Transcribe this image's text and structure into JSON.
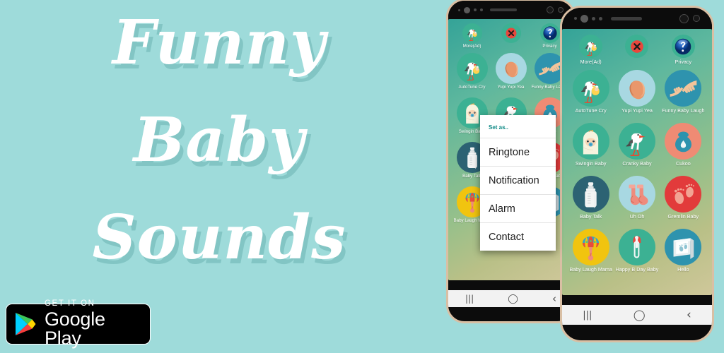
{
  "promo": {
    "title_lines": [
      "Funny",
      "Baby",
      "Sounds"
    ],
    "background_color": "#9edbda",
    "title_color": "#ffffff",
    "title_shadow_color": "#78bebc"
  },
  "store_badge": {
    "small_label": "GET IT ON",
    "big_label": "Google Play",
    "icon": "google-play-triangle-icon",
    "background_color": "#000000",
    "border_color": "#ffffff"
  },
  "phones": {
    "back": {
      "label": "background-phone",
      "frame_color": "#d9bfa4",
      "bezel_color": "#0c0c0c"
    },
    "front": {
      "label": "foreground-phone",
      "frame_color": "#d9bfa4",
      "bezel_color": "#0c0c0c"
    }
  },
  "app": {
    "screen_gradient": [
      "#34a398",
      "#5fb89e",
      "#97c08a",
      "#cfc79a"
    ],
    "top_row": [
      {
        "label": "More(Ad)",
        "icon": "stork-carrying-baby-icon",
        "circle_color": "#3cb193"
      },
      {
        "label": "",
        "icon": "red-x-close-icon",
        "circle_color": "#3cb193"
      },
      {
        "label": "Privacy",
        "icon": "question-mark-help-icon",
        "circle_color": "#3cb193"
      }
    ],
    "sounds": [
      {
        "label": "AutoTune Cry",
        "icon": "stork-carrying-baby-icon",
        "circle_color": "#3cb193"
      },
      {
        "label": "Yupi Yupi Yea",
        "icon": "baby-head-icon",
        "circle_color": "#a8d8e2"
      },
      {
        "label": "Funny Baby Laugh",
        "icon": "two-hands-touching-icon",
        "circle_color": "#2e93ae"
      },
      {
        "label": "Swingin Baby",
        "icon": "swaddled-baby-icon",
        "circle_color": "#3cb193"
      },
      {
        "label": "Cranky Baby",
        "icon": "stork-standing-icon",
        "circle_color": "#3cb193"
      },
      {
        "label": "Cukoo",
        "icon": "baby-bib-icon",
        "circle_color": "#ef8b74"
      },
      {
        "label": "Baby Talk",
        "icon": "baby-bottle-icon",
        "circle_color": "#2c6273"
      },
      {
        "label": "Uh Oh",
        "icon": "baby-socks-icon",
        "circle_color": "#a8d8e2"
      },
      {
        "label": "Gremlin Baby",
        "icon": "baby-footprints-icon",
        "circle_color": "#e23b3b"
      },
      {
        "label": "Baby Laugh Mama",
        "icon": "baby-rattle-icon",
        "circle_color": "#f1c40f"
      },
      {
        "label": "Happy B Day Baby",
        "icon": "safety-pin-icon",
        "circle_color": "#3cb193"
      },
      {
        "label": "Hello",
        "icon": "baby-footprint-photo-frame-icon",
        "circle_color": "#2e93ae"
      }
    ],
    "nav_bar": {
      "recents": "|||",
      "home": "◯",
      "back": "‹"
    }
  },
  "context_menu": {
    "header": "Set as..",
    "header_color": "#0f8a86",
    "items": [
      "Ringtone",
      "Notification",
      "Alarm",
      "Contact"
    ]
  }
}
